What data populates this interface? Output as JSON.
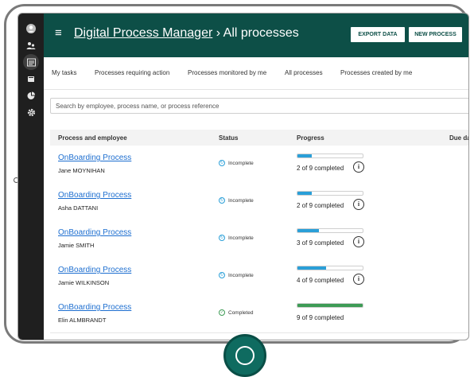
{
  "header": {
    "app_link": "Digital Process Manager",
    "separator": "›",
    "page": "All processes",
    "export_label": "EXPORT DATA",
    "new_label": "NEW PROCESS"
  },
  "sidebar_icons": [
    "user-icon",
    "people-icon",
    "list-icon",
    "book-icon",
    "pie-chart-icon",
    "gear-icon"
  ],
  "tabs": [
    "My tasks",
    "Processes requiring action",
    "Processes monitored by me",
    "All processes",
    "Processes created by me"
  ],
  "search": {
    "placeholder": "Search by employee, process name, or process reference"
  },
  "table": {
    "columns": [
      "Process and employee",
      "Status",
      "Progress",
      "Due date"
    ],
    "rows": [
      {
        "process": "OnBoarding Process",
        "employee": "Jane MOYNIHAN",
        "status": "Incomplete",
        "progress_text": "2 of 9 completed",
        "completed": 2,
        "total": 9,
        "due": ""
      },
      {
        "process": "OnBoarding Process",
        "employee": "Asha DATTANI",
        "status": "Incomplete",
        "progress_text": "2 of 9 completed",
        "completed": 2,
        "total": 9,
        "due": ""
      },
      {
        "process": "OnBoarding Process",
        "employee": "Jamie SMITH",
        "status": "Incomplete",
        "progress_text": "3 of 9 completed",
        "completed": 3,
        "total": 9,
        "due": "–"
      },
      {
        "process": "OnBoarding Process",
        "employee": "Jamie WILKINSON",
        "status": "Incomplete",
        "progress_text": "4 of 9 completed",
        "completed": 4,
        "total": 9,
        "due": "–"
      },
      {
        "process": "OnBoarding Process",
        "employee": "Elin ALMBRANDT",
        "status": "Completed",
        "progress_text": "9 of 9 completed",
        "completed": 9,
        "total": 9,
        "due": "–"
      }
    ]
  },
  "colors": {
    "header": "#0d4f47",
    "sidebar": "#1f1f1f",
    "link": "#1e6fd0",
    "progress": "#2a9fd8",
    "complete": "#3d9b55",
    "home_button": "#0f6b60"
  }
}
